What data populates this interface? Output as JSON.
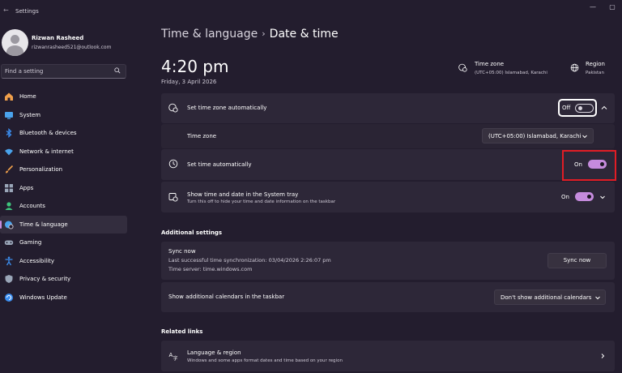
{
  "window": {
    "title": "Settings",
    "back_glyph": "←",
    "controls": [
      "—",
      "▢"
    ]
  },
  "profile": {
    "name": "Rizwan Rasheed",
    "email": "rizwanrasheed521@outlook.com"
  },
  "search": {
    "placeholder": "Find a setting",
    "icon": "search-icon"
  },
  "nav": {
    "items": [
      {
        "label": "Home",
        "icon": "home-icon",
        "color": "#f0a04b"
      },
      {
        "label": "System",
        "icon": "system-icon",
        "color": "#4aa3ec"
      },
      {
        "label": "Bluetooth & devices",
        "icon": "bluetooth-icon",
        "color": "#3b8ef0"
      },
      {
        "label": "Network & internet",
        "icon": "wifi-icon",
        "color": "#4aa3ec"
      },
      {
        "label": "Personalization",
        "icon": "brush-icon",
        "color": "#f0a04b"
      },
      {
        "label": "Apps",
        "icon": "apps-icon",
        "color": "#9aa6b8"
      },
      {
        "label": "Accounts",
        "icon": "accounts-icon",
        "color": "#3ec47c"
      },
      {
        "label": "Time & language",
        "icon": "globe-clock-icon",
        "color": "#4aa3ec",
        "active": true
      },
      {
        "label": "Gaming",
        "icon": "gamepad-icon",
        "color": "#9aa6b8"
      },
      {
        "label": "Accessibility",
        "icon": "accessibility-icon",
        "color": "#3b8ef0"
      },
      {
        "label": "Privacy & security",
        "icon": "shield-icon",
        "color": "#9aa6b8"
      },
      {
        "label": "Windows Update",
        "icon": "update-icon",
        "color": "#3b8ef0"
      }
    ]
  },
  "breadcrumb": {
    "parent": "Time & language",
    "separator": "›",
    "current": "Date & time"
  },
  "clock": {
    "time": "4:20 pm",
    "date": "Friday, 3 April 2026"
  },
  "summary": {
    "timezone_title": "Time zone",
    "timezone_value": "(UTC+05:00) Islamabad, Karachi",
    "region_title": "Region",
    "region_value": "Pakistan"
  },
  "settings": {
    "auto_timezone": {
      "title": "Set time zone automatically",
      "state": "Off"
    },
    "timezone": {
      "title": "Time zone",
      "value": "(UTC+05:00) Islamabad, Karachi"
    },
    "auto_time": {
      "title": "Set time automatically",
      "state": "On"
    },
    "tray": {
      "title": "Show time and date in the System tray",
      "subtitle": "Turn this off to hide your time and date information on the taskbar",
      "state": "On"
    }
  },
  "additional": {
    "heading": "Additional settings",
    "sync": {
      "title": "Sync now",
      "last_sync": "Last successful time synchronization: 03/04/2026 2:26:07 pm",
      "server": "Time server: time.windows.com",
      "button": "Sync now"
    },
    "calendars": {
      "title": "Show additional calendars in the taskbar",
      "value": "Don't show additional calendars"
    }
  },
  "related": {
    "heading": "Related links",
    "language_region": {
      "title": "Language & region",
      "subtitle": "Windows and some apps format dates and time based on your region"
    }
  },
  "colors": {
    "accent": "#c58bdd",
    "background": "#231d2e",
    "card": "#2d2738",
    "highlight": "#e11d25"
  }
}
